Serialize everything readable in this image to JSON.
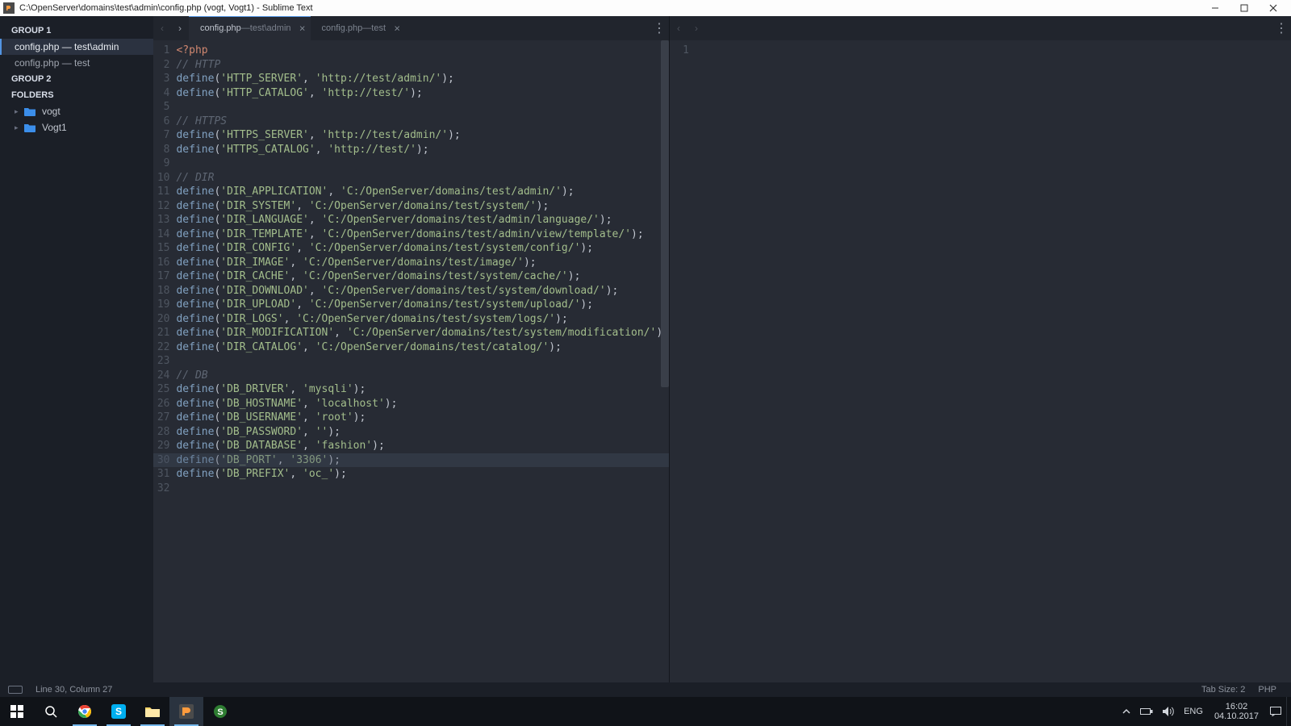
{
  "window": {
    "title": "C:\\OpenServer\\domains\\test\\admin\\config.php (vogt, Vogt1) - Sublime Text"
  },
  "sidebar": {
    "group1": "GROUP 1",
    "g1_items": [
      "config.php — test\\admin",
      "config.php — test"
    ],
    "group2": "GROUP 2",
    "folders_hdr": "FOLDERS",
    "folders": [
      "vogt",
      "Vogt1"
    ]
  },
  "tabs_left": [
    {
      "name": "config.php",
      "path": "test\\admin",
      "active": true
    },
    {
      "name": "config.php",
      "path": "test",
      "active": false
    }
  ],
  "glyph": {
    "sep": " — ",
    "close": "×",
    "dots": "⋮",
    "left": "‹",
    "right": "›",
    "tri": "▸"
  },
  "right_pane": {
    "gutter": [
      "1"
    ]
  },
  "code": {
    "lines": [
      {
        "n": 1,
        "t": "php",
        "txt": "<?php"
      },
      {
        "n": 2,
        "t": "cmt",
        "txt": "// HTTP"
      },
      {
        "n": 3,
        "t": "def",
        "k": "HTTP_SERVER",
        "v": "http://test/admin/"
      },
      {
        "n": 4,
        "t": "def",
        "k": "HTTP_CATALOG",
        "v": "http://test/"
      },
      {
        "n": 5,
        "t": "blank"
      },
      {
        "n": 6,
        "t": "cmt",
        "txt": "// HTTPS"
      },
      {
        "n": 7,
        "t": "def",
        "k": "HTTPS_SERVER",
        "v": "http://test/admin/"
      },
      {
        "n": 8,
        "t": "def",
        "k": "HTTPS_CATALOG",
        "v": "http://test/"
      },
      {
        "n": 9,
        "t": "blank"
      },
      {
        "n": 10,
        "t": "cmt",
        "txt": "// DIR"
      },
      {
        "n": 11,
        "t": "def",
        "k": "DIR_APPLICATION",
        "v": "C:/OpenServer/domains/test/admin/"
      },
      {
        "n": 12,
        "t": "def",
        "k": "DIR_SYSTEM",
        "v": "C:/OpenServer/domains/test/system/"
      },
      {
        "n": 13,
        "t": "def",
        "k": "DIR_LANGUAGE",
        "v": "C:/OpenServer/domains/test/admin/language/"
      },
      {
        "n": 14,
        "t": "def",
        "k": "DIR_TEMPLATE",
        "v": "C:/OpenServer/domains/test/admin/view/template/"
      },
      {
        "n": 15,
        "t": "def",
        "k": "DIR_CONFIG",
        "v": "C:/OpenServer/domains/test/system/config/"
      },
      {
        "n": 16,
        "t": "def",
        "k": "DIR_IMAGE",
        "v": "C:/OpenServer/domains/test/image/"
      },
      {
        "n": 17,
        "t": "def",
        "k": "DIR_CACHE",
        "v": "C:/OpenServer/domains/test/system/cache/"
      },
      {
        "n": 18,
        "t": "def",
        "k": "DIR_DOWNLOAD",
        "v": "C:/OpenServer/domains/test/system/download/"
      },
      {
        "n": 19,
        "t": "def",
        "k": "DIR_UPLOAD",
        "v": "C:/OpenServer/domains/test/system/upload/"
      },
      {
        "n": 20,
        "t": "def",
        "k": "DIR_LOGS",
        "v": "C:/OpenServer/domains/test/system/logs/"
      },
      {
        "n": 21,
        "t": "def",
        "k": "DIR_MODIFICATION",
        "v": "C:/OpenServer/domains/test/system/modification/"
      },
      {
        "n": 22,
        "t": "def",
        "k": "DIR_CATALOG",
        "v": "C:/OpenServer/domains/test/catalog/"
      },
      {
        "n": 23,
        "t": "blank"
      },
      {
        "n": 24,
        "t": "cmt",
        "txt": "// DB"
      },
      {
        "n": 25,
        "t": "def",
        "k": "DB_DRIVER",
        "v": "mysqli"
      },
      {
        "n": 26,
        "t": "def",
        "k": "DB_HOSTNAME",
        "v": "localhost"
      },
      {
        "n": 27,
        "t": "def",
        "k": "DB_USERNAME",
        "v": "root"
      },
      {
        "n": 28,
        "t": "def",
        "k": "DB_PASSWORD",
        "v": ""
      },
      {
        "n": 29,
        "t": "def",
        "k": "DB_DATABASE",
        "v": "fashion"
      },
      {
        "n": 30,
        "t": "def",
        "k": "DB_PORT",
        "v": "3306"
      },
      {
        "n": 31,
        "t": "def",
        "k": "DB_PREFIX",
        "v": "oc_"
      },
      {
        "n": 32,
        "t": "blank"
      }
    ],
    "highlight_line": 30
  },
  "status": {
    "pos": "Line 30, Column 27",
    "tabsize": "Tab Size: 2",
    "lang": "PHP"
  },
  "tray": {
    "lang": "ENG",
    "time": "16:02",
    "date": "04.10.2017"
  }
}
